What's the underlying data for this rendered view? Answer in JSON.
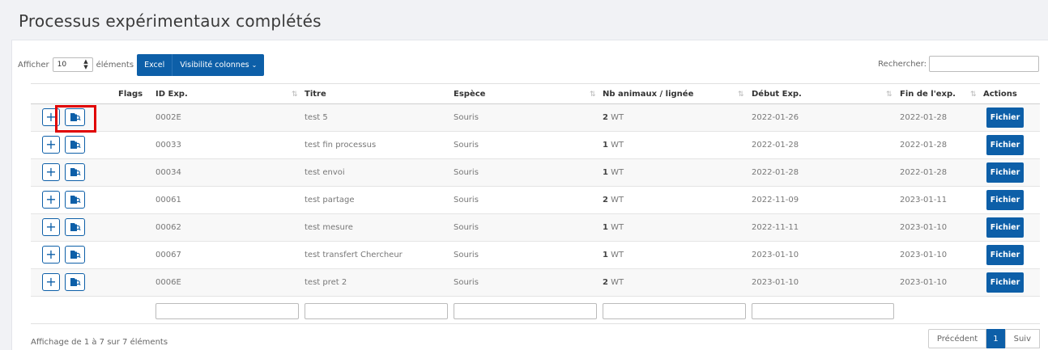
{
  "page": {
    "title": "Processus expérimentaux complétés"
  },
  "toolbar": {
    "show_prefix": "Afficher",
    "page_size": "10",
    "show_suffix": "éléments",
    "excel_label": "Excel",
    "columns_label": "Visibilité colonnes",
    "search_label": "Rechercher:",
    "search_value": ""
  },
  "table": {
    "headers": {
      "flags": "Flags",
      "id": "ID Exp.",
      "title": "Titre",
      "species": "Espèce",
      "animals": "Nb animaux / lignée",
      "start": "Début Exp.",
      "end": "Fin de l'exp.",
      "actions": "Actions"
    },
    "rows": [
      {
        "id": "0002E",
        "title": "test 5",
        "species": "Souris",
        "count": "2",
        "line": "WT",
        "start": "2022-01-26",
        "end": "2022-01-28",
        "action": "Fichier"
      },
      {
        "id": "00033",
        "title": "test fin processus",
        "species": "Souris",
        "count": "1",
        "line": "WT",
        "start": "2022-01-28",
        "end": "2022-01-28",
        "action": "Fichier"
      },
      {
        "id": "00034",
        "title": "test envoi",
        "species": "Souris",
        "count": "1",
        "line": "WT",
        "start": "2022-01-28",
        "end": "2022-01-28",
        "action": "Fichier"
      },
      {
        "id": "00061",
        "title": "test partage",
        "species": "Souris",
        "count": "2",
        "line": "WT",
        "start": "2022-11-09",
        "end": "2023-01-11",
        "action": "Fichier"
      },
      {
        "id": "00062",
        "title": "test mesure",
        "species": "Souris",
        "count": "1",
        "line": "WT",
        "start": "2022-11-11",
        "end": "2023-01-10",
        "action": "Fichier"
      },
      {
        "id": "00067",
        "title": "test transfert Chercheur",
        "species": "Souris",
        "count": "1",
        "line": "WT",
        "start": "2023-01-10",
        "end": "2023-01-10",
        "action": "Fichier"
      },
      {
        "id": "0006E",
        "title": "test pret 2",
        "species": "Souris",
        "count": "2",
        "line": "WT",
        "start": "2023-01-10",
        "end": "2023-01-10",
        "action": "Fichier"
      }
    ]
  },
  "footer": {
    "info": "Affichage de 1 à 7 sur 7 éléments",
    "prev": "Précédent",
    "current": "1",
    "next": "Suiv"
  },
  "icons": {
    "expand": "plus-icon",
    "view": "file-search-icon",
    "sort": "sort-arrows-icon",
    "select": "select-arrows-icon",
    "dropdown": "chevron-down-icon"
  },
  "colors": {
    "accent": "#0d5fa8",
    "highlight": "#e00000"
  }
}
